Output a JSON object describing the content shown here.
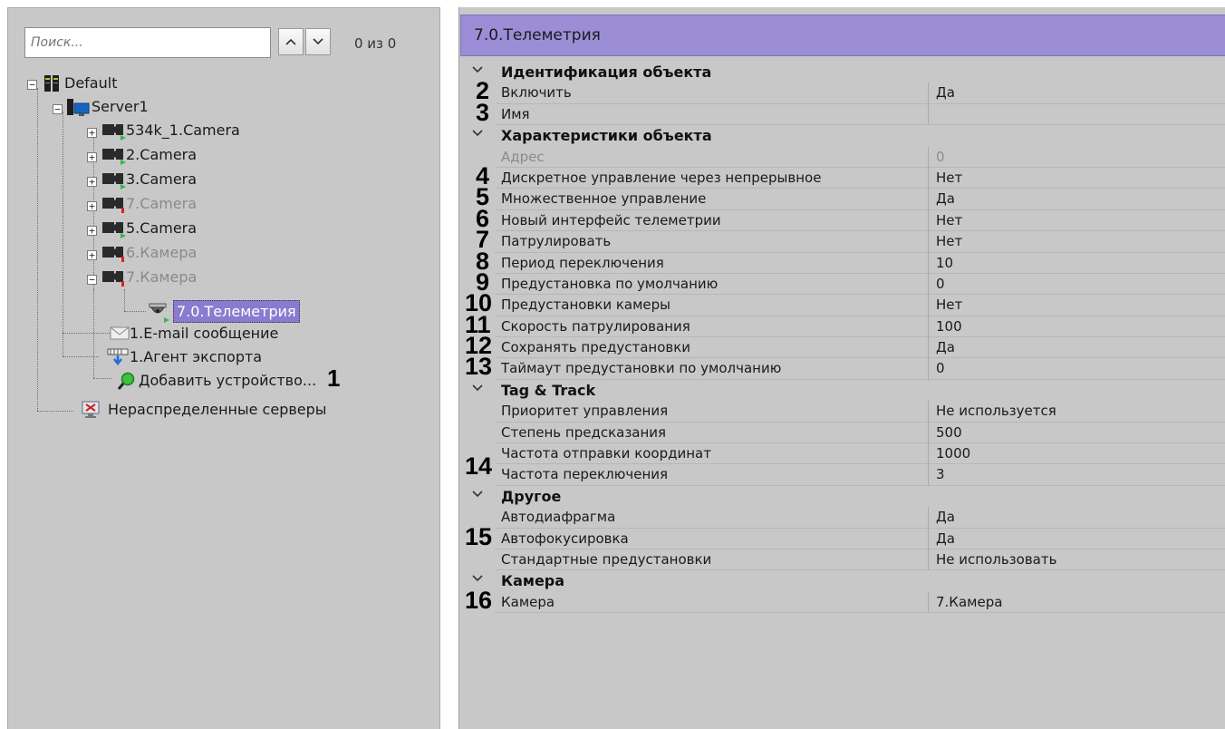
{
  "colors": {
    "selection": "#8a7bd0",
    "header": "#9b8ed6",
    "panel": "#c8c8c8"
  },
  "search": {
    "placeholder": "Поиск...",
    "up_icon": "chevron-up-icon",
    "down_icon": "chevron-down-icon",
    "count": "0 из 0"
  },
  "tree": {
    "root": {
      "label": "Default",
      "icon": "server-rack-icon"
    },
    "server": {
      "label": "Server1",
      "icon": "computer-icon"
    },
    "items": [
      {
        "label": "534k_1.Camera",
        "icon": "camera-icon",
        "state": "ok"
      },
      {
        "label": "2.Camera",
        "icon": "camera-icon",
        "state": "ok"
      },
      {
        "label": "3.Camera",
        "icon": "camera-icon",
        "state": "ok"
      },
      {
        "label": "7.Camera",
        "icon": "camera-icon",
        "state": "disabled"
      },
      {
        "label": "5.Camera",
        "icon": "camera-icon",
        "state": "error"
      },
      {
        "label": "6.Камера",
        "icon": "camera-icon",
        "state": "disabled"
      },
      {
        "label": "7.Камера",
        "icon": "camera-icon",
        "state": "disabled"
      }
    ],
    "telemetry": {
      "label": "7.0.Телеметрия",
      "icon": "ptz-dome-icon",
      "callout": "1"
    },
    "email": {
      "label": "1.E-mail сообщение",
      "icon": "envelope-icon"
    },
    "export": {
      "label": "1.Агент экспорта",
      "icon": "export-agent-icon"
    },
    "add": {
      "label": "Добавить устройство...",
      "icon": "magnifier-add-icon"
    },
    "unassigned": {
      "label": "Нераспределенные серверы",
      "icon": "unassigned-server-icon"
    }
  },
  "panel": {
    "title": "7.0.Телеметрия"
  },
  "groups": [
    {
      "name": "Идентификация объекта",
      "rows": [
        {
          "num": "2",
          "name": "Включить",
          "value": "Да"
        },
        {
          "num": "3",
          "name": "Имя",
          "value": ""
        }
      ]
    },
    {
      "name": "Характеристики объекта",
      "rows": [
        {
          "num": "",
          "name": "Адрес",
          "value": "0",
          "dim": true
        },
        {
          "num": "4",
          "name": "Дискретное управление через непрерывное",
          "value": "Нет"
        },
        {
          "num": "5",
          "name": "Множественное управление",
          "value": "Да"
        },
        {
          "num": "6",
          "name": "Новый интерфейс телеметрии",
          "value": "Нет"
        },
        {
          "num": "7",
          "name": "Патрулировать",
          "value": "Нет"
        },
        {
          "num": "8",
          "name": "Период переключения",
          "value": "10"
        },
        {
          "num": "9",
          "name": "Предустановка по умолчанию",
          "value": "0"
        },
        {
          "num": "10",
          "name": "Предустановки камеры",
          "value": "Нет"
        },
        {
          "num": "11",
          "name": "Скорость патрулирования",
          "value": "100"
        },
        {
          "num": "12",
          "name": "Сохранять предустановки",
          "value": "Да"
        },
        {
          "num": "13",
          "name": "Таймаут предустановки по умолчанию",
          "value": "0"
        }
      ]
    },
    {
      "name": "Tag & Track",
      "rows": [
        {
          "num": "",
          "name": "Приоритет управления",
          "value": "Не используется"
        },
        {
          "num": "",
          "name": "Степень предсказания",
          "value": "500"
        },
        {
          "num": "14",
          "name": "Частота отправки координат",
          "value": "1000"
        },
        {
          "num": "",
          "name": "Частота переключения",
          "value": "3"
        }
      ]
    },
    {
      "name": "Другое",
      "rows": [
        {
          "num": "",
          "name": "Автодиафрагма",
          "value": "Да"
        },
        {
          "num": "15",
          "name": "Автофокусировка",
          "value": "Да"
        },
        {
          "num": "",
          "name": "Стандартные предустановки",
          "value": "Не использовать"
        }
      ]
    },
    {
      "name": "Камера",
      "rows": [
        {
          "num": "16",
          "name": "Камера",
          "value": "7.Камера"
        }
      ]
    }
  ]
}
